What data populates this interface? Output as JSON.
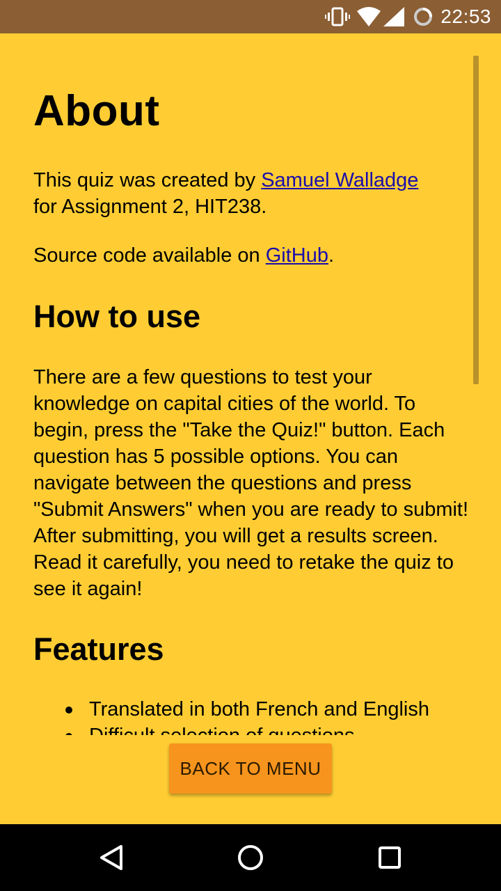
{
  "status_bar": {
    "time": "22:53",
    "icons": [
      "vibrate-icon",
      "wifi-icon",
      "signal-icon",
      "battery-loading-icon"
    ]
  },
  "about": {
    "title": "About",
    "intro_prefix": "This quiz was created by ",
    "author_link": "Samuel Walladge",
    "intro_suffix": "for Assignment 2, HIT238.",
    "source_prefix": "Source code available on ",
    "source_link": "GitHub",
    "source_suffix": "."
  },
  "how_to_use": {
    "heading": "How to use",
    "body": "There are a few questions to test your knowledge on capital cities of the world. To begin, press the \"Take the Quiz!\" button. Each question has 5 possible options. You can navigate between the questions and press \"Submit Answers\" when you are ready to submit! After submitting, you will get a results screen. Read it carefully, you need to retake the quiz to see it again!"
  },
  "features": {
    "heading": "Features",
    "items": [
      "Translated in both French and English",
      "Difficult selection of questions"
    ]
  },
  "actions": {
    "back_to_menu": "BACK TO MENU"
  },
  "nav": {
    "icons": [
      "back-icon",
      "home-icon",
      "recents-icon"
    ]
  },
  "colors": {
    "background": "#FFCD33",
    "status_bar": "#8B5E34",
    "button": "#F7941D",
    "link": "#1a0dab"
  }
}
